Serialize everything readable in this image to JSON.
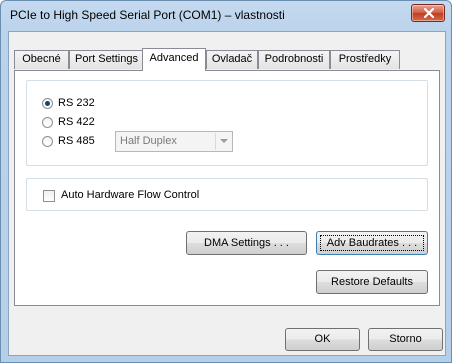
{
  "window": {
    "title": "PCIe to High Speed Serial Port (COM1) – vlastnosti",
    "close_icon": "close-icon"
  },
  "tabs": [
    {
      "label": "Obecné"
    },
    {
      "label": "Port Settings"
    },
    {
      "label": "Advanced",
      "active": true
    },
    {
      "label": "Ovladač"
    },
    {
      "label": "Podrobnosti"
    },
    {
      "label": "Prostředky"
    }
  ],
  "advanced": {
    "mode_options": [
      {
        "label": "RS 232",
        "selected": true
      },
      {
        "label": "RS 422",
        "selected": false
      },
      {
        "label": "RS 485",
        "selected": false
      }
    ],
    "duplex_select": {
      "value": "Half Duplex",
      "enabled": false
    },
    "auto_flow_control": {
      "label": "Auto Hardware Flow Control",
      "checked": false
    },
    "dma_settings_label": "DMA Settings . . .",
    "adv_baudrates_label": "Adv Baudrates . . .",
    "restore_defaults_label": "Restore Defaults"
  },
  "footer": {
    "ok_label": "OK",
    "cancel_label": "Storno"
  }
}
